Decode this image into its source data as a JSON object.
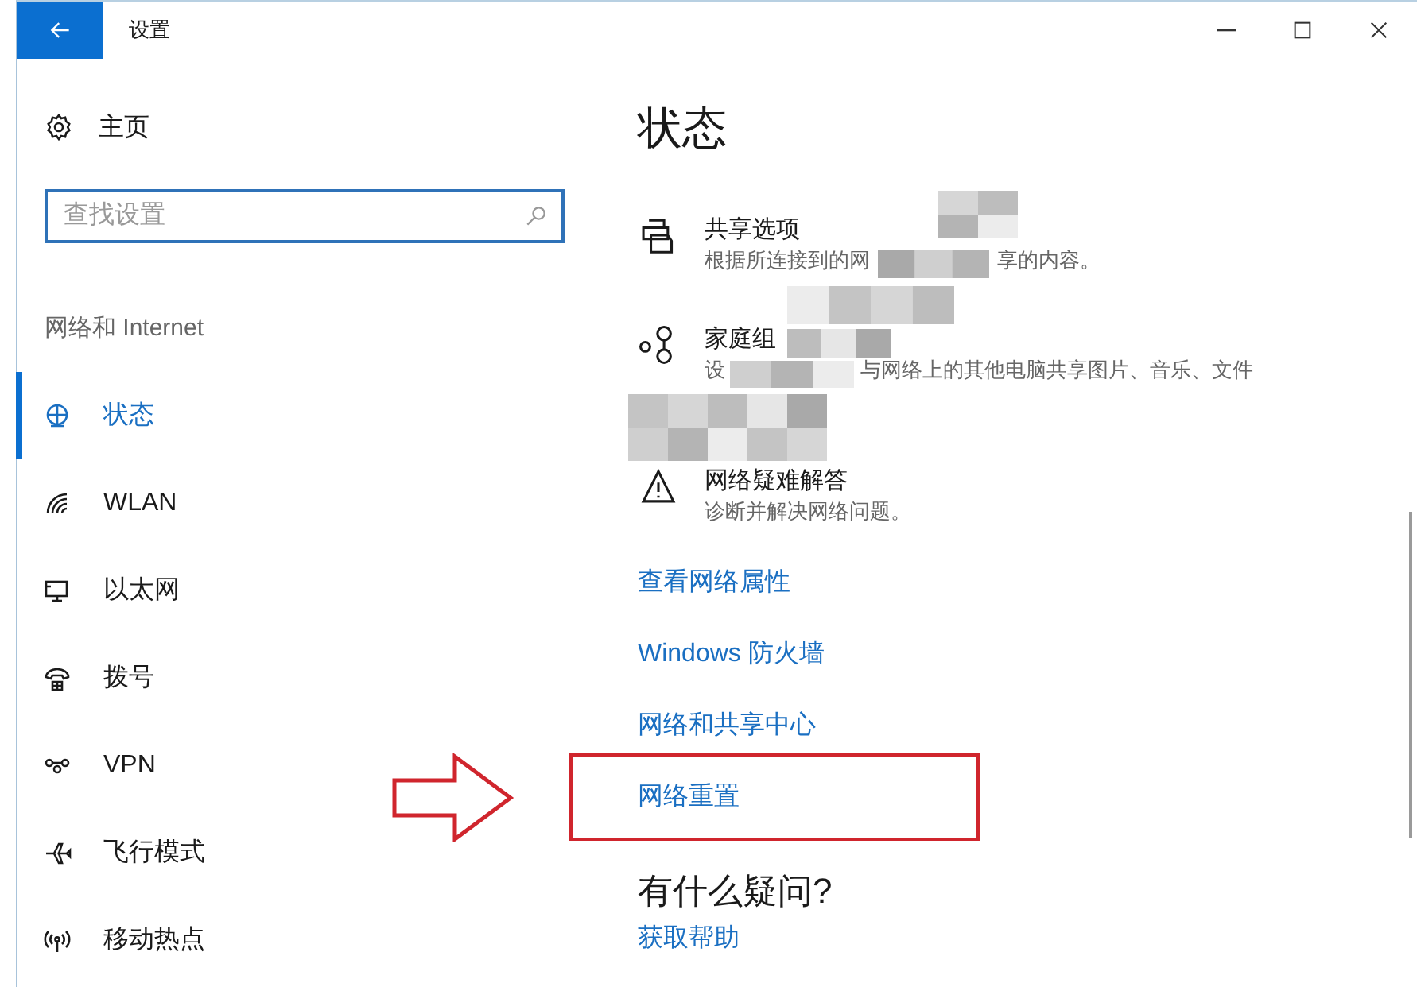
{
  "window": {
    "title": "设置"
  },
  "sidebar": {
    "home": "主页",
    "search": {
      "placeholder": "查找设置"
    },
    "section": "网络和 Internet",
    "items": [
      {
        "kind": "status",
        "label": "状态",
        "selected": true
      },
      {
        "kind": "wlan",
        "label": "WLAN",
        "selected": false
      },
      {
        "kind": "ethernet",
        "label": "以太网",
        "selected": false
      },
      {
        "kind": "dialup",
        "label": "拨号",
        "selected": false
      },
      {
        "kind": "vpn",
        "label": "VPN",
        "selected": false
      },
      {
        "kind": "airplane",
        "label": "飞行模式",
        "selected": false
      },
      {
        "kind": "hotspot",
        "label": "移动热点",
        "selected": false
      }
    ]
  },
  "main": {
    "title": "状态",
    "options": [
      {
        "kind": "sharing",
        "title": "共享选项",
        "description": [
          "根据所连接到的网",
          "享的内容。"
        ]
      },
      {
        "kind": "homegroup",
        "title": "家庭组",
        "description": [
          "设",
          "与网络上的其他电脑共享图片、音乐、文件"
        ]
      },
      {
        "kind": "troubleshoot",
        "title": "网络疑难解答",
        "description": [
          "诊断并解决网络问题。"
        ]
      }
    ],
    "links": [
      {
        "label": "查看网络属性",
        "highlighted": false
      },
      {
        "label": "Windows 防火墙",
        "highlighted": false
      },
      {
        "label": "网络和共享中心",
        "highlighted": false
      },
      {
        "label": "网络重置",
        "highlighted": true
      }
    ],
    "help": {
      "heading": "有什么疑问?",
      "link": "获取帮助"
    }
  }
}
